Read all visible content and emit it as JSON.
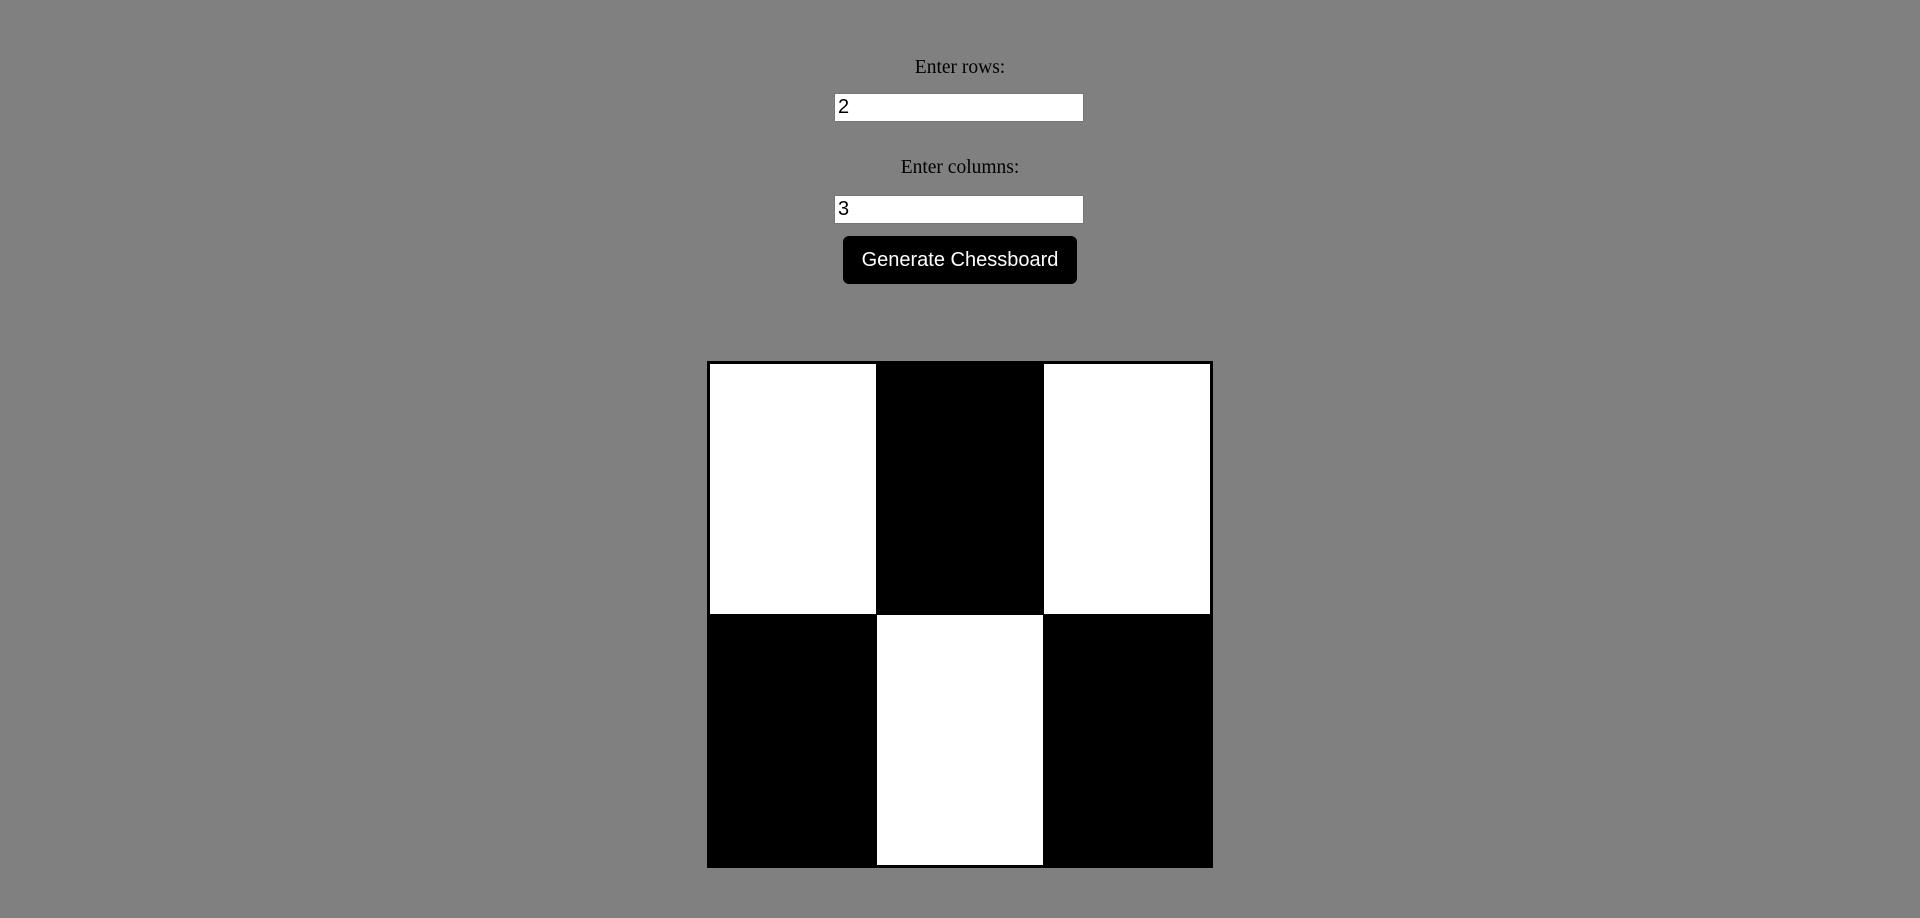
{
  "form": {
    "rows_label": "Enter rows:",
    "rows_value": "2",
    "cols_label": "Enter columns:",
    "cols_value": "3",
    "generate_label": "Generate Chessboard"
  },
  "board": {
    "rows": 2,
    "cols": 3,
    "light_color": "#ffffff",
    "dark_color": "#000000",
    "background_color": "#808080"
  }
}
